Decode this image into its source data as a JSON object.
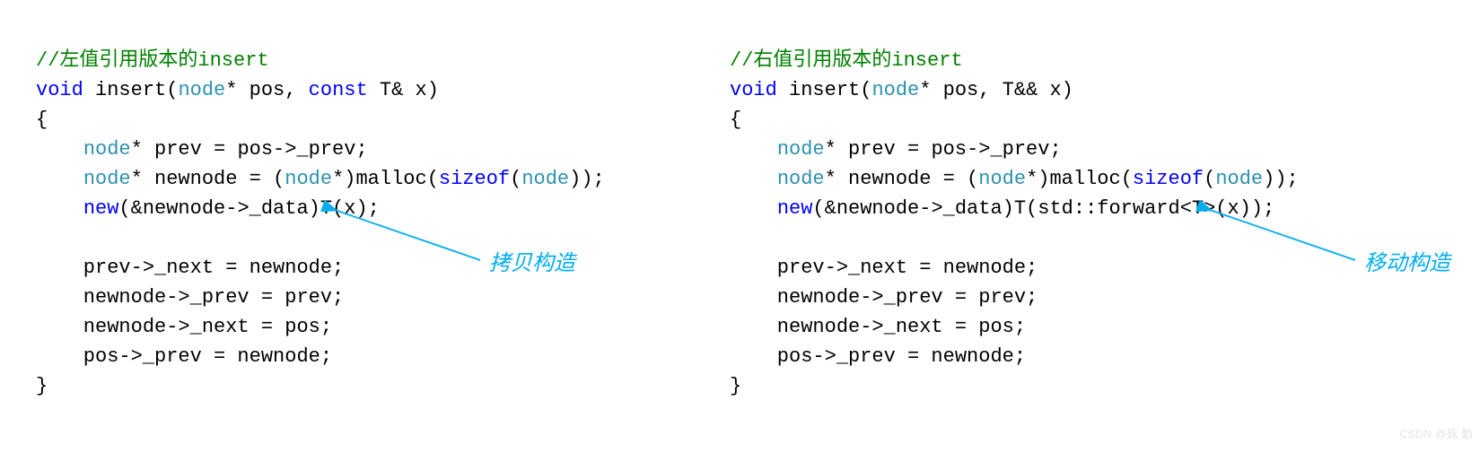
{
  "left": {
    "comment": "//左值引用版本的insert",
    "sig_void": "void",
    "sig_text1": " insert(",
    "sig_node1": "node",
    "sig_text2": "* pos, ",
    "sig_const": "const",
    "sig_text3": " T& x)",
    "brace_open": "{",
    "l1a": "    ",
    "l1_node": "node",
    "l1b": "* prev = pos->_prev;",
    "l2a": "    ",
    "l2_node": "node",
    "l2b": "* newnode = (",
    "l2_node2": "node",
    "l2c": "*)malloc(",
    "l2_sizeof": "sizeof",
    "l2d": "(",
    "l2_node3": "node",
    "l2e": "));",
    "l3a": "    ",
    "l3_new": "new",
    "l3b": "(&newnode->_data)T(x);",
    "blank": "",
    "l4": "    prev->_next = newnode;",
    "l5": "    newnode->_prev = prev;",
    "l6": "    newnode->_next = pos;",
    "l7": "    pos->_prev = newnode;",
    "brace_close": "}",
    "annotation": "拷贝构造"
  },
  "right": {
    "comment": "//右值引用版本的insert",
    "sig_void": "void",
    "sig_text1": " insert(",
    "sig_node1": "node",
    "sig_text2": "* pos, T&& x)",
    "brace_open": "{",
    "l1a": "    ",
    "l1_node": "node",
    "l1b": "* prev = pos->_prev;",
    "l2a": "    ",
    "l2_node": "node",
    "l2b": "* newnode = (",
    "l2_node2": "node",
    "l2c": "*)malloc(",
    "l2_sizeof": "sizeof",
    "l2d": "(",
    "l2_node3": "node",
    "l2e": "));",
    "l3a": "    ",
    "l3_new": "new",
    "l3b": "(&newnode->_data)T(std::forward<T>(x));",
    "blank": "",
    "l4": "    prev->_next = newnode;",
    "l5": "    newnode->_prev = prev;",
    "l6": "    newnode->_next = pos;",
    "l7": "    pos->_prev = newnode;",
    "brace_close": "}",
    "annotation": "移动构造"
  },
  "watermark": "CSDN @砾 勤"
}
